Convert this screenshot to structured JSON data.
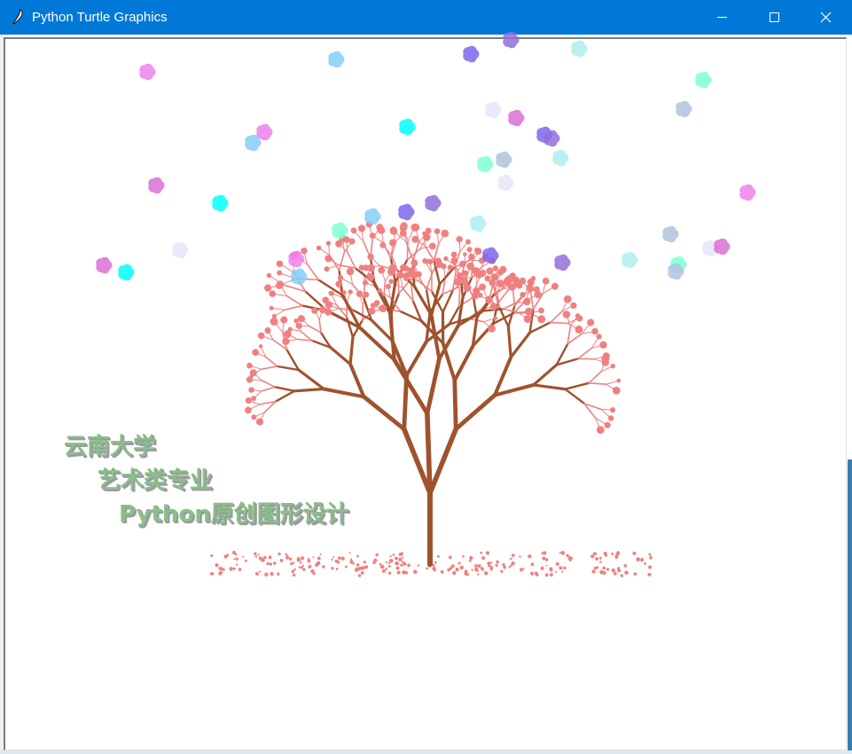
{
  "window": {
    "title": "Python Turtle Graphics",
    "icon": "feather-icon",
    "titlebar_color": "#0078d7",
    "controls": [
      "minimize-icon",
      "maximize-icon",
      "close-icon"
    ]
  },
  "canvas": {
    "background": "#ffffff",
    "caption_lines": [
      "云南大学",
      "艺术类专业",
      "Python原创图形设计"
    ],
    "caption_color": "#8bbf84",
    "trunk_color": "#a0522d",
    "blossom_color": "#f08080",
    "petal_colors": [
      "#ee82ee",
      "#87cefa",
      "#7b68ee",
      "#9370db",
      "#afeeee",
      "#7fffd4",
      "#b0c4de",
      "#e6e6fa",
      "#da70d6",
      "#00ffff"
    ]
  }
}
